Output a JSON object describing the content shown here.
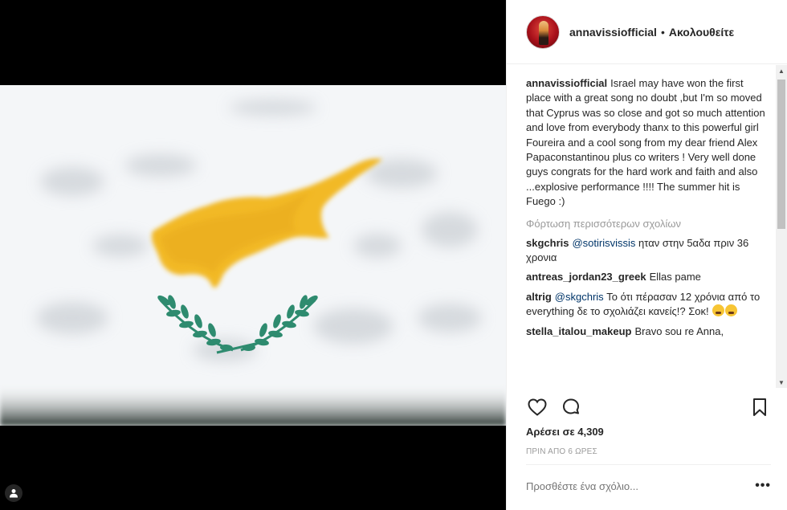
{
  "header": {
    "username": "annavissiofficial",
    "separator": "•",
    "follow_label": "Ακολουθείτε"
  },
  "caption": {
    "username": "annavissiofficial",
    "text": "Israel may have won the first place with a great song no doubt ,but I'm so moved that Cyprus was so close and got so much attention and love from everybody thanx to this powerful girl Foureira and a cool song from my dear friend Alex Papaconstantinou plus co writers ! Very well done guys congrats for the hard work and faith and also ...explosive performance !!!! The summer hit is Fuego :)"
  },
  "load_more": "Φόρτωση περισσότερων σχολίων",
  "comments": [
    {
      "username": "skgchris",
      "mention": "@sotirisvissis",
      "text": " ηταν στην 5αδα πριν 36 χρονια"
    },
    {
      "username": "antreas_jordan23_greek",
      "mention": "",
      "text": "Ellas pame"
    },
    {
      "username": "altrig",
      "mention": "@skgchris",
      "text": " Το ότι πέρασαν 12 χρόνια από το everything δε το σχολιάζει κανείς!? Σοκ! "
    },
    {
      "username": "stella_italou_makeup",
      "mention": "",
      "text": "Bravo sou re Anna,"
    }
  ],
  "likes": "Αρέσει σε 4,309",
  "timestamp": "ΠΡΙΝ ΑΠΟ 6 ΩΡΕΣ",
  "add_comment_placeholder": "Προσθέστε ένα σχόλιο...",
  "more_label": "•••",
  "icons": {
    "like": "heart-icon",
    "comment": "comment-bubble-icon",
    "save": "bookmark-icon",
    "user_tag": "user-silhouette-icon"
  },
  "colors": {
    "flag_copper": "#f2b926",
    "olive_branch": "#2e8b6f",
    "mention_link": "#003569",
    "muted_text": "#999999"
  }
}
